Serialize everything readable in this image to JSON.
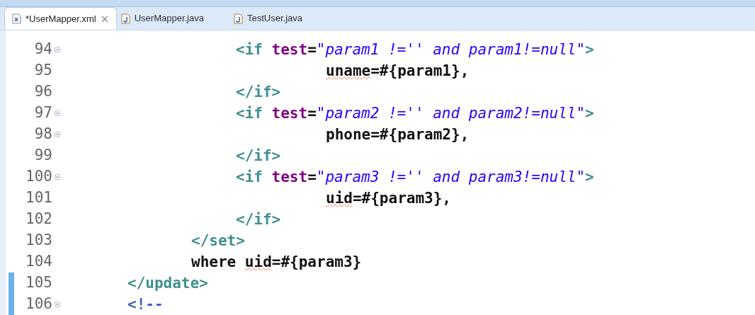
{
  "tabs": [
    {
      "label": "*UserMapper.xml",
      "kind": "xml",
      "selected": true,
      "closable": true
    },
    {
      "label": "UserMapper.java",
      "kind": "java",
      "selected": false,
      "closable": false
    },
    {
      "label": "TestUser.java",
      "kind": "java",
      "selected": false,
      "closable": false
    }
  ],
  "editor": {
    "lines": [
      {
        "number": "94",
        "kind": "condition",
        "foldable": true,
        "changed": false,
        "tokens": [
          {
            "kind": "tag",
            "text": "<if "
          },
          {
            "kind": "attr",
            "text": "test"
          },
          {
            "kind": "text",
            "text": "="
          },
          {
            "kind": "string",
            "text": "\"param1 !='' and param1!=null\""
          },
          {
            "kind": "tag",
            "text": ">"
          }
        ]
      },
      {
        "number": "95",
        "kind": "assignment",
        "foldable": false,
        "changed": false,
        "tokens": [
          {
            "kind": "text",
            "text": "uname",
            "misspelled": true
          },
          {
            "kind": "text",
            "text": "=#{param1},"
          }
        ]
      },
      {
        "number": "96",
        "kind": "condition",
        "foldable": false,
        "changed": false,
        "tokens": [
          {
            "kind": "tag",
            "text": "</if>"
          }
        ]
      },
      {
        "number": "97",
        "kind": "condition",
        "foldable": true,
        "changed": false,
        "tokens": [
          {
            "kind": "tag",
            "text": "<if "
          },
          {
            "kind": "attr",
            "text": "test"
          },
          {
            "kind": "text",
            "text": "="
          },
          {
            "kind": "string",
            "text": "\"param2 !='' and param2!=null\""
          },
          {
            "kind": "tag",
            "text": ">"
          }
        ]
      },
      {
        "number": "98",
        "kind": "assignment",
        "foldable": true,
        "changed": false,
        "tokens": [
          {
            "kind": "text",
            "text": "phone=#{param2},"
          }
        ]
      },
      {
        "number": "99",
        "kind": "condition",
        "foldable": false,
        "changed": false,
        "tokens": [
          {
            "kind": "tag",
            "text": "</if>"
          }
        ]
      },
      {
        "number": "100",
        "kind": "condition",
        "foldable": true,
        "changed": false,
        "tokens": [
          {
            "kind": "tag",
            "text": "<if "
          },
          {
            "kind": "attr",
            "text": "test"
          },
          {
            "kind": "text",
            "text": "="
          },
          {
            "kind": "string",
            "text": "\"param3 !='' and param3!=null\""
          },
          {
            "kind": "tag",
            "text": ">"
          }
        ]
      },
      {
        "number": "101",
        "kind": "assignment",
        "foldable": false,
        "changed": false,
        "tokens": [
          {
            "kind": "text",
            "text": "uid",
            "misspelled": true
          },
          {
            "kind": "text",
            "text": "=#{param3},"
          }
        ]
      },
      {
        "number": "102",
        "kind": "condition",
        "foldable": false,
        "changed": false,
        "tokens": [
          {
            "kind": "tag",
            "text": "</if>"
          }
        ]
      },
      {
        "number": "103",
        "kind": "block",
        "foldable": false,
        "changed": false,
        "tokens": [
          {
            "kind": "tag",
            "text": "</set>"
          }
        ]
      },
      {
        "number": "104",
        "kind": "block",
        "foldable": false,
        "changed": false,
        "tokens": [
          {
            "kind": "text",
            "text": "where "
          },
          {
            "kind": "text",
            "text": "uid",
            "misspelled": true
          },
          {
            "kind": "text",
            "text": "=#{param3}"
          }
        ]
      },
      {
        "number": "105",
        "kind": "root",
        "foldable": false,
        "changed": true,
        "tokens": [
          {
            "kind": "tag",
            "text": "</update>"
          }
        ]
      },
      {
        "number": "106",
        "kind": "root",
        "foldable": true,
        "changed": true,
        "tokens": [
          {
            "kind": "comment",
            "text": "<!--"
          }
        ]
      }
    ]
  }
}
